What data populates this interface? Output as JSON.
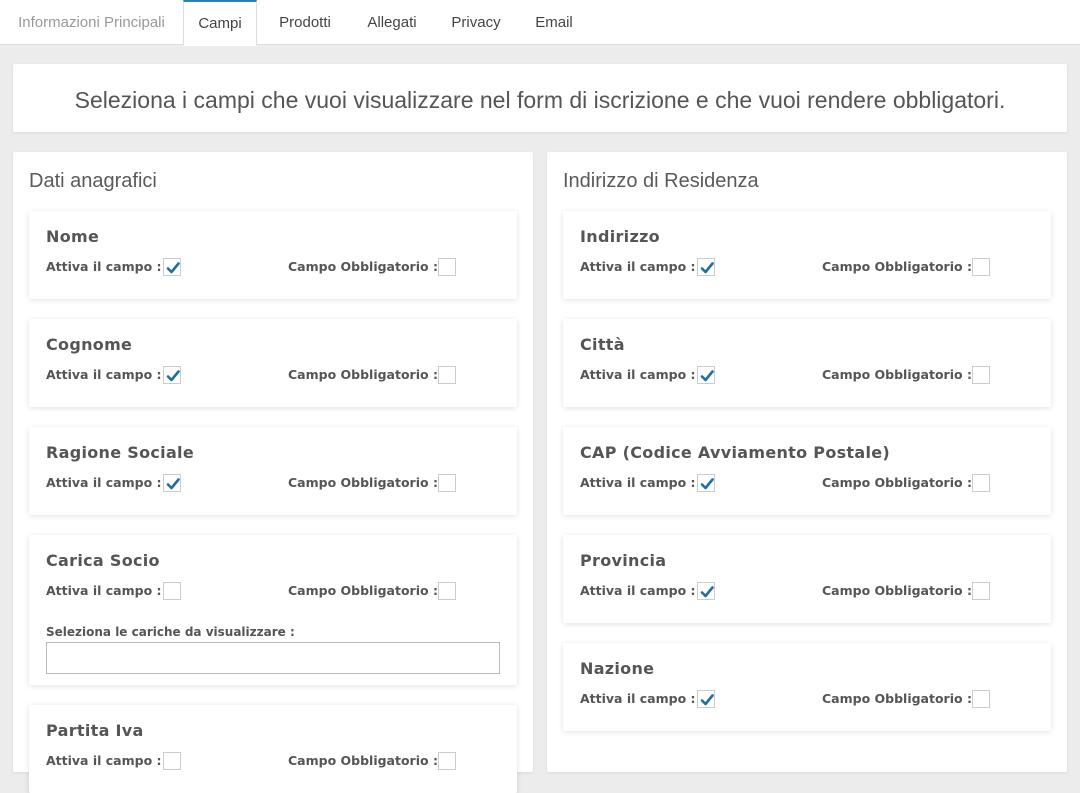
{
  "tabs": [
    {
      "label": "Informazioni Principali",
      "state": "muted"
    },
    {
      "label": "Campi",
      "state": "active"
    },
    {
      "label": "Prodotti",
      "state": "normal"
    },
    {
      "label": "Allegati",
      "state": "normal"
    },
    {
      "label": "Privacy",
      "state": "normal"
    },
    {
      "label": "Email",
      "state": "normal"
    }
  ],
  "banner": {
    "text": "Seleziona i campi che vuoi visualizzare nel form di iscrizione e che vuoi rendere obbligatori."
  },
  "labels": {
    "active": "Attiva il campo :",
    "required": "Campo Obbligatorio :"
  },
  "left_panel": {
    "title": "Dati anagrafici",
    "cards": [
      {
        "title": "Nome",
        "active": true,
        "required": false
      },
      {
        "title": "Cognome",
        "active": true,
        "required": false
      },
      {
        "title": "Ragione Sociale",
        "active": true,
        "required": false
      },
      {
        "title": "Carica Socio",
        "active": false,
        "required": false,
        "sub_label": "Seleziona le cariche da visualizzare :",
        "sub_value": ""
      },
      {
        "title": "Partita Iva",
        "active": false,
        "required": false
      }
    ]
  },
  "right_panel": {
    "title": "Indirizzo di Residenza",
    "cards": [
      {
        "title": "Indirizzo",
        "active": true,
        "required": false
      },
      {
        "title": "Città",
        "active": true,
        "required": false
      },
      {
        "title": "CAP (Codice Avviamento Postale)",
        "active": true,
        "required": false
      },
      {
        "title": "Provincia",
        "active": true,
        "required": false
      },
      {
        "title": "Nazione",
        "active": true,
        "required": false
      }
    ]
  },
  "colors": {
    "accent": "#2a7fbd",
    "check": "#1f6f9f"
  }
}
